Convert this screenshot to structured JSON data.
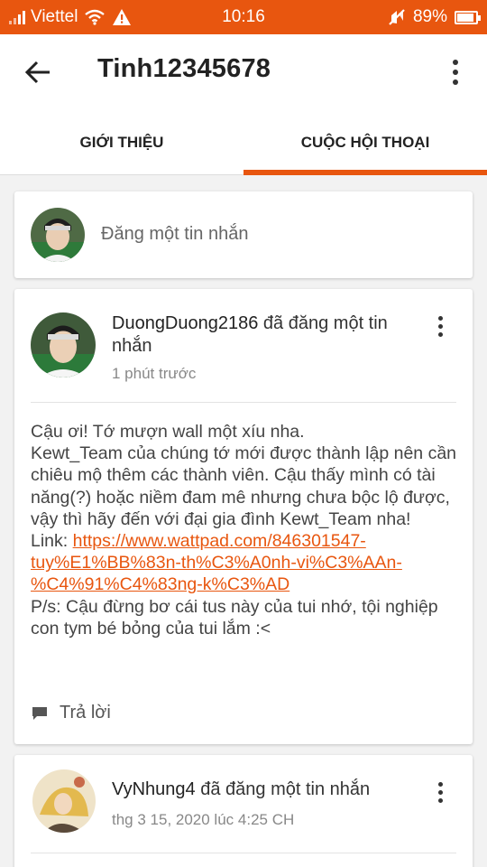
{
  "status_bar": {
    "carrier": "Viettel",
    "time": "10:16",
    "battery": "89%",
    "battery_level": 0.89,
    "icons": [
      "signal-icon",
      "wifi-icon",
      "warning-icon",
      "mute-icon",
      "battery-icon"
    ]
  },
  "app_bar": {
    "title": "Tinh12345678"
  },
  "tabs": {
    "items": [
      {
        "label": "GIỚI THIỆU"
      },
      {
        "label": "CUỘC HỘI THOẠI"
      }
    ],
    "active_index": 1
  },
  "compose": {
    "placeholder": "Đăng một tin nhắn"
  },
  "posts": [
    {
      "username": "DuongDuong2186",
      "action": " đã đăng một tin nhắn",
      "time": "1 phút trước",
      "body_before_link": "Cậu ơi! Tớ mượn wall một xíu nha.\nKewt_Team của chúng tớ mới được thành lập nên cần chiêu mộ thêm các thành viên. Cậu thấy mình có tài năng(?) hoặc niềm đam mê nhưng chưa bộc lộ được, vậy thì hãy đến với đại gia đình Kewt_Team nha!\nLink: ",
      "link": "https://www.wattpad.com/846301547-tuy%E1%BB%83n-th%C3%A0nh-vi%C3%AAn-%C4%91%C4%83ng-k%C3%AD",
      "body_after_link": "\nP/s: Cậu đừng bơ cái tus này của tui nhớ, tội nghiệp con tym bé bỏng của tui lắm :<",
      "reply_label": "Trả lời"
    },
    {
      "username": "VyNhung4",
      "action": " đã đăng một tin nhắn",
      "time": "thg 3 15, 2020 lúc 4:25 CH"
    }
  ],
  "colors": {
    "accent": "#e8560f",
    "background": "#f2f2f2"
  }
}
